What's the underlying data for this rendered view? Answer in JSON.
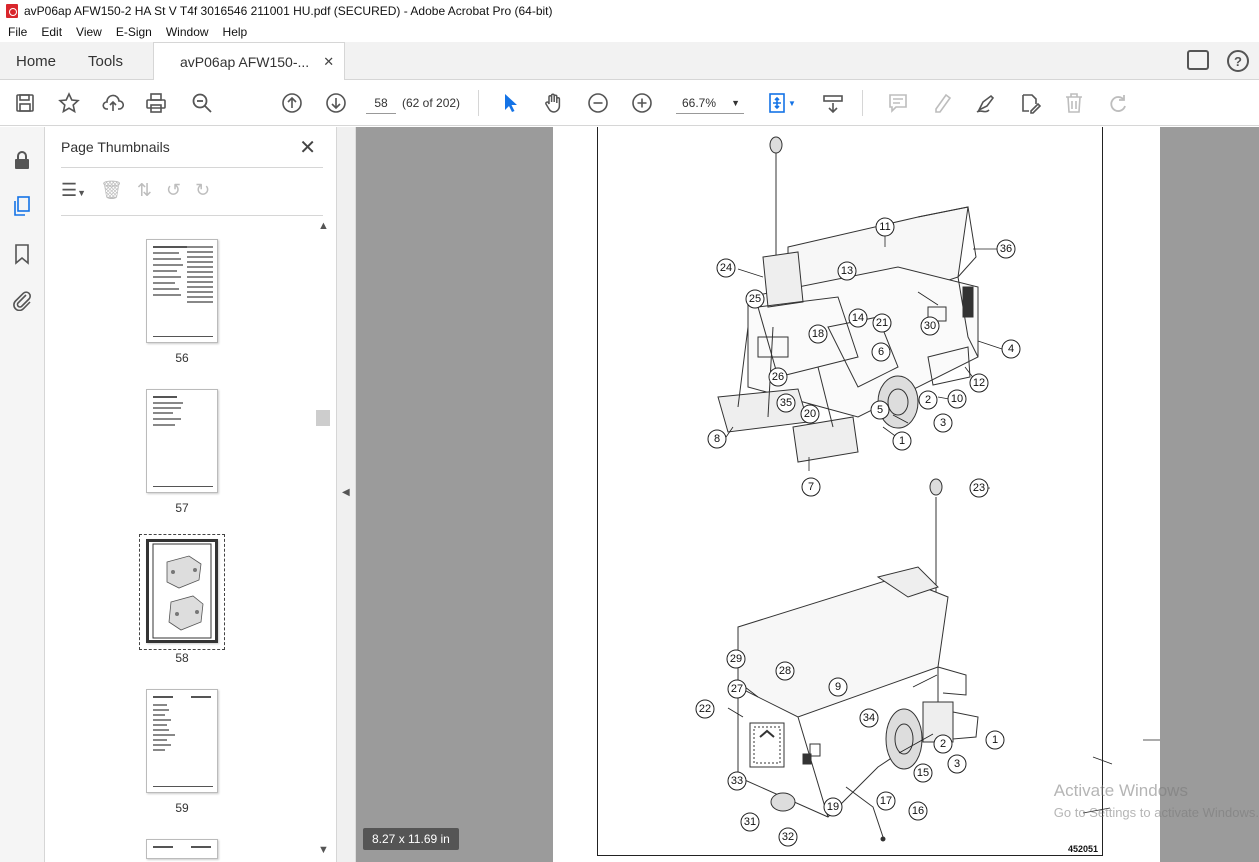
{
  "window": {
    "title": "avP06ap AFW150-2 HA St V T4f 3016546 211001 HU.pdf (SECURED) - Adobe Acrobat Pro (64-bit)"
  },
  "menu": [
    "File",
    "Edit",
    "View",
    "E-Sign",
    "Window",
    "Help"
  ],
  "tabs": {
    "home": "Home",
    "tools": "Tools",
    "document": "avP06ap AFW150-...",
    "close": "✕"
  },
  "toolbar": {
    "page_current": "58",
    "page_count": "(62 of 202)",
    "zoom": "66.7%"
  },
  "thumbnails": {
    "title": "Page Thumbnails",
    "close": "✕",
    "pages": [
      {
        "label": "56"
      },
      {
        "label": "57"
      },
      {
        "label": "58",
        "selected": true
      },
      {
        "label": "59"
      }
    ]
  },
  "viewer": {
    "page_size": "8.27 x 11.69 in",
    "doc_number": "452051",
    "callouts_top": [
      "11",
      "36",
      "24",
      "13",
      "25",
      "14",
      "21",
      "30",
      "4",
      "18",
      "6",
      "12",
      "26",
      "2",
      "10",
      "35",
      "20",
      "5",
      "3",
      "8",
      "1",
      "7"
    ],
    "callouts_bottom": [
      "23",
      "29",
      "28",
      "9",
      "27",
      "22",
      "34",
      "1",
      "2",
      "3",
      "15",
      "33",
      "17",
      "16",
      "19",
      "31",
      "32"
    ]
  },
  "watermark": {
    "line1": "Activate Windows",
    "line2": "Go to Settings to activate Windows."
  },
  "colors": {
    "accent": "#1473e6",
    "viewer_bg": "#9b9b9b",
    "pdf_red": "#d9262c"
  }
}
